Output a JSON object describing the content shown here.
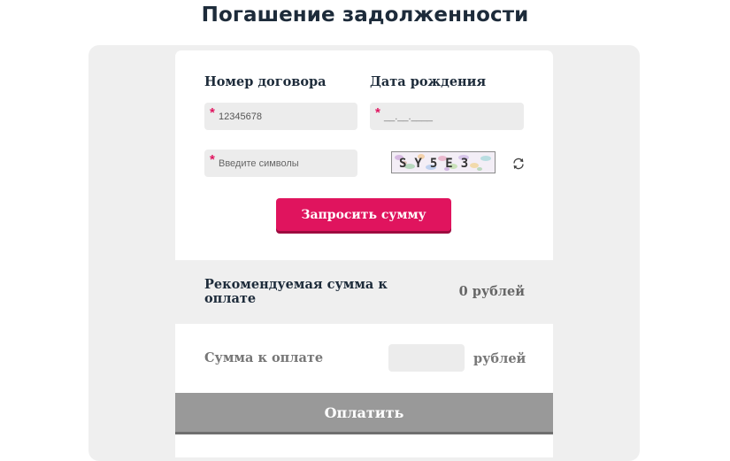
{
  "page_title": "Погашение задолженности",
  "form": {
    "contract_label": "Номер договора",
    "contract_value": "12345678",
    "birth_label": "Дата рождения",
    "birth_placeholder": "__.__.____",
    "captcha_placeholder": "Введите символы",
    "captcha_text": "SY5E3",
    "required_mark": "*",
    "request_button": "Запросить сумму"
  },
  "recommended": {
    "label": "Рекомендуемая сумма к оплате",
    "amount": "0 рублей"
  },
  "payment": {
    "label": "Сумма к оплате",
    "currency": "рублей",
    "pay_button": "Оплатить"
  },
  "colors": {
    "accent": "#e0145e",
    "title": "#1d2b3a",
    "disabled_button": "#999999"
  },
  "icons": {
    "refresh": "refresh-icon"
  }
}
